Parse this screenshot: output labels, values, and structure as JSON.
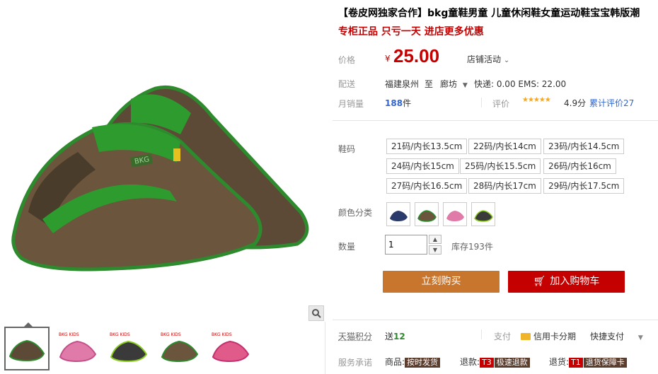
{
  "title": "【卷皮网独家合作】bkg童鞋男童 儿童休闲鞋女童运动鞋宝宝韩版潮",
  "subtitle": "专柜正品 只亏一天 进店更多优惠",
  "price": {
    "label": "价格",
    "currency": "¥",
    "value": "25.00",
    "promo": "店铺活动"
  },
  "shipping": {
    "label": "配送",
    "from": "福建泉州",
    "to_word": "至",
    "to": "廊坊",
    "fees": "快递: 0.00 EMS: 22.00"
  },
  "sales": {
    "label": "月销量",
    "count": "188",
    "unit": "件",
    "rating_label": "评价",
    "stars": "★★★★★",
    "score": "4.9分",
    "total": "累计评价27"
  },
  "sizes": {
    "label": "鞋码",
    "options": [
      "21码/内长13.5cm",
      "22码/内长14cm",
      "23码/内长14.5cm",
      "24码/内长15cm",
      "25码/内长15.5cm",
      "26码/内长16cm",
      "27码/内长16.5cm",
      "28码/内长17cm",
      "29码/内长17.5cm"
    ]
  },
  "colors": {
    "label": "颜色分类",
    "swatches": [
      "#2a3a6a",
      "#6a5a3a",
      "#e07aa8",
      "#3a3a3a"
    ]
  },
  "quantity": {
    "label": "数量",
    "value": "1",
    "stock": "库存193件"
  },
  "buttons": {
    "buy": "立刻购买",
    "cart": "加入购物车"
  },
  "points": {
    "label": "天猫积分",
    "text": "送",
    "value": "12",
    "pay_label": "支付",
    "pay_method": "信用卡分期",
    "quick_pay": "快捷支付"
  },
  "service": {
    "label": "服务承诺",
    "goods": "商品:",
    "goods_badge": "按时发货",
    "refund": "退款:",
    "refund_code": "T3",
    "refund_badge": "极速退款",
    "return": "退货:",
    "return_code": "T1",
    "return_badge": "退货保障卡"
  },
  "colors_theme": {
    "price_red": "#c40000",
    "buy_orange": "#c8762d",
    "cart_red": "#c40000"
  }
}
